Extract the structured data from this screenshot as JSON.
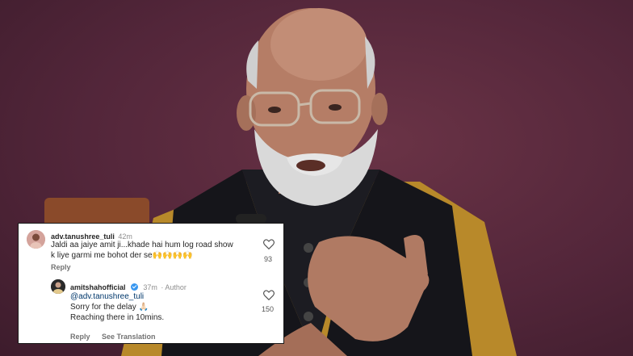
{
  "comments": [
    {
      "username": "adv.tanushree_tuli",
      "time": "42m",
      "text_line1": "Jaldi aa jaiye amit ji...khade hai hum log road show",
      "text_line2": "k liye garmi me bohot der se🙌🙌🙌🙌",
      "reply_label": "Reply",
      "likes": "93"
    },
    {
      "username": "amitshahofficial",
      "time": "37m",
      "badge": "· Author",
      "mention": "@adv.tanushree_tuli",
      "text_line1": "Sorry for the delay 🙏🏻",
      "text_line2": "Reaching there in 10mins.",
      "reply_label": "Reply",
      "translation_label": "See Translation",
      "likes": "150"
    }
  ],
  "colors": {
    "background": "#5a2a3a",
    "card": "#ffffff",
    "mention": "#00376b",
    "verified": "#3897f0"
  }
}
